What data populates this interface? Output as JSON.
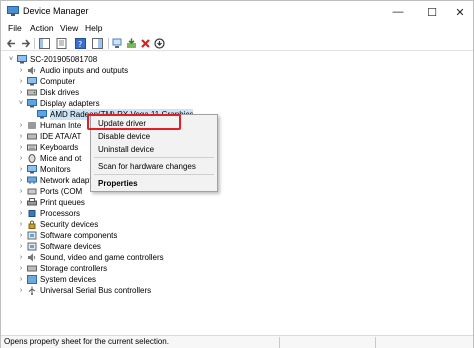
{
  "window": {
    "title": "Device Manager",
    "controls": {
      "minimize": "—",
      "maximize": "☐",
      "close": "✕"
    }
  },
  "menu": [
    "File",
    "Action",
    "View",
    "Help"
  ],
  "toolbar": {
    "buttons": [
      "back-icon",
      "forward-icon",
      "show-hide-console-tree-icon",
      "properties-icon",
      "help-icon",
      "action-pane-icon",
      "scan-hardware-icon",
      "update-driver-icon",
      "uninstall-device-icon",
      "disable-device-icon"
    ]
  },
  "tree": {
    "root": "SC-201905081708",
    "items": [
      "Audio inputs and outputs",
      "Computer",
      "Disk drives",
      "Display adapters",
      "AMD Radeon(TM) RX Vega 11 Graphics",
      "Human Inte",
      "IDE ATA/AT",
      "Keyboards",
      "Mice and ot",
      "Monitors",
      "Network adapte",
      "Ports (COM",
      "Print queues",
      "Processors",
      "Security devices",
      "Software components",
      "Software devices",
      "Sound, video and game controllers",
      "Storage controllers",
      "System devices",
      "Universal Serial Bus controllers"
    ]
  },
  "context_menu": {
    "items": [
      "Update driver",
      "Disable device",
      "Uninstall device",
      "Scan for hardware changes",
      "Properties"
    ]
  },
  "status_bar": {
    "text": "Opens property sheet for the current selection."
  },
  "colors": {
    "highlight_border": "#e01f26",
    "folder_blue": "#2b6cb0"
  }
}
